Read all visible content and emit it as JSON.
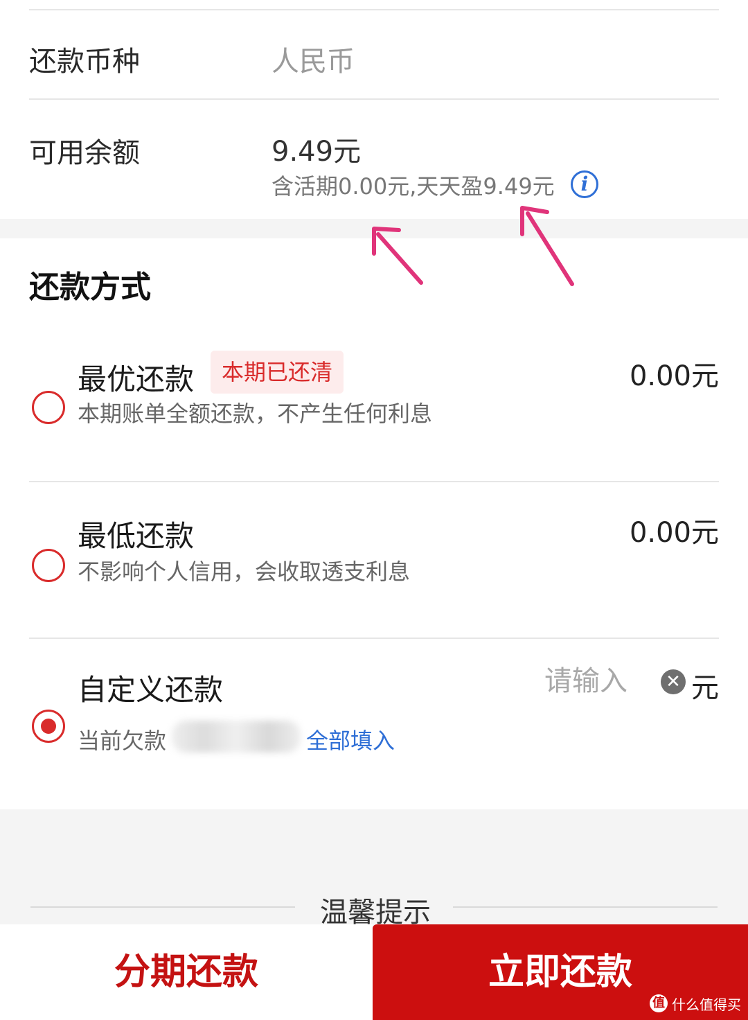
{
  "currency": {
    "label": "还款币种",
    "value": "人民币"
  },
  "balance": {
    "label": "可用余额",
    "value": "9.49元",
    "detail": "含活期0.00元,天天盈9.49元",
    "info_icon": "info-icon"
  },
  "method": {
    "title": "还款方式",
    "options": [
      {
        "title": "最优还款",
        "badge": "本期已还清",
        "desc": "本期账单全额还款，不产生任何利息",
        "amount": "0.00元",
        "checked": false
      },
      {
        "title": "最低还款",
        "desc": "不影响个人信用，会收取透支利息",
        "amount": "0.00元",
        "checked": false
      },
      {
        "title": "自定义还款",
        "placeholder": "请输入",
        "unit": "元",
        "desc_prefix": "当前欠款",
        "fill_all": "全部填入",
        "checked": true
      }
    ]
  },
  "tips": {
    "title": "温馨提示"
  },
  "buttons": {
    "installment": "分期还款",
    "pay_now": "立即还款"
  },
  "watermark": {
    "logo": "值",
    "text": "什么值得买"
  },
  "colors": {
    "accent": "#cc0f0f",
    "link": "#2f6fd6",
    "arrow": "#e0347a"
  }
}
